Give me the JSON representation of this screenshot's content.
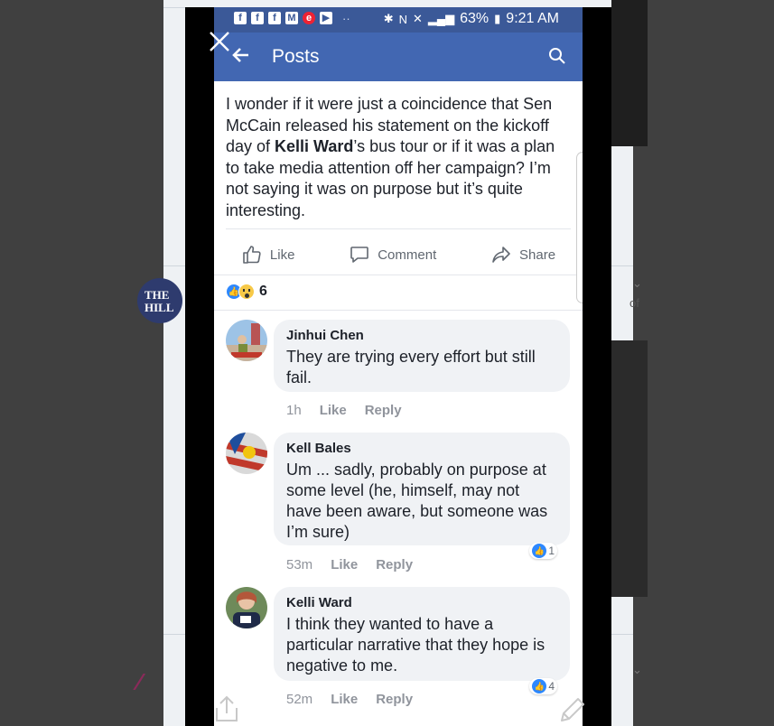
{
  "colors": {
    "fb_blue": "#4267b2",
    "status_blue": "#3b5998",
    "like_blue": "#2d88ff",
    "text": "#1d2129",
    "muted": "#90949c"
  },
  "statusbar": {
    "battery": "63%",
    "time": "9:21 AM",
    "icons": [
      "facebook-icon",
      "facebook-icon",
      "facebook-icon",
      "gmail-icon",
      "app-icon",
      "youtube-icon",
      "bluetooth-icon",
      "nfc-icon",
      "mute-icon",
      "lte-icon",
      "signal-icon",
      "battery-icon"
    ]
  },
  "appbar": {
    "title": "Posts"
  },
  "post": {
    "text_before": "I wonder if it were just a coincidence that Sen McCain released his statement on the kickoff day of ",
    "text_bold": "Kelli Ward",
    "text_after": "’s bus tour or if it was a plan to take media attention off her campaign? I’m not saying it was on purpose but it’s quite interesting."
  },
  "actions": {
    "like": "Like",
    "comment": "Comment",
    "share": "Share"
  },
  "reactions": {
    "count": "6"
  },
  "comments": [
    {
      "name": "Jinhui Chen",
      "text": "They are trying every effort but still fail.",
      "time": "1h",
      "like": "Like",
      "reply": "Reply",
      "likes": ""
    },
    {
      "name": "Kell Bales",
      "text": "Um ... sadly, probably on purpose at some level (he, himself, may not have been aware, but someone was I’m sure)",
      "time": "53m",
      "like": "Like",
      "reply": "Reply",
      "likes": "1"
    },
    {
      "name": "Kelli Ward",
      "text": "I think they wanted to have a particular narrative that they hope is negative to me.",
      "time": "52m",
      "like": "Like",
      "reply": "Reply",
      "likes": "4"
    }
  ],
  "background": {
    "logo_text": "THE HILL",
    "of_text": "of"
  }
}
